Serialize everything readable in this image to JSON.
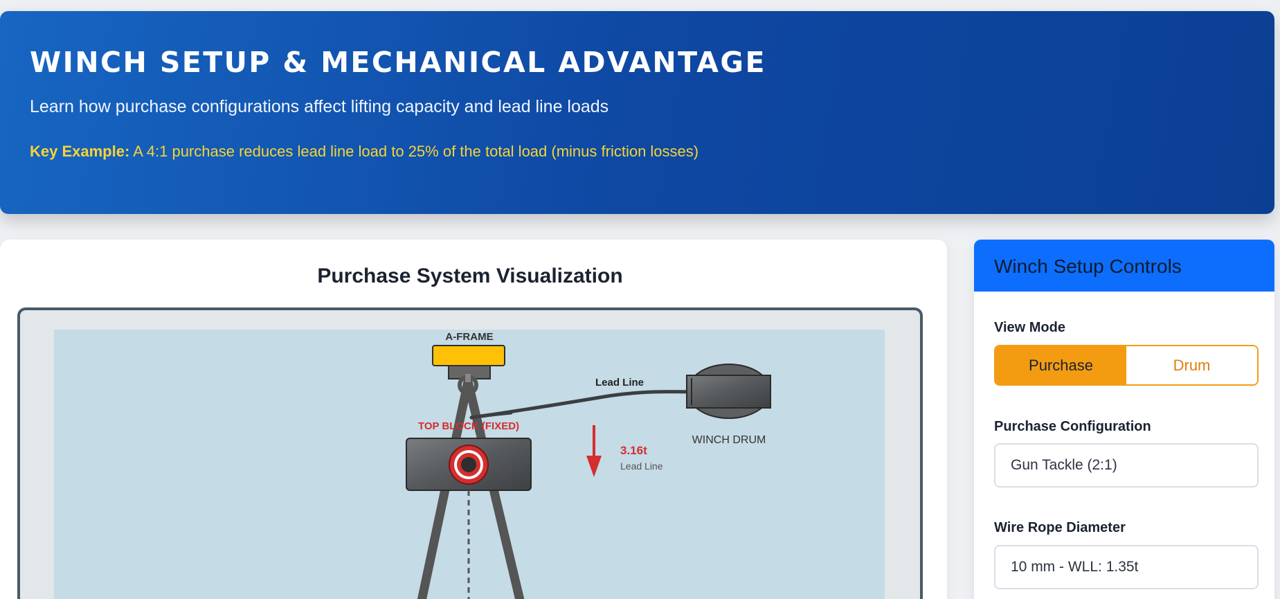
{
  "hero": {
    "title": "Winch Setup & Mechanical Advantage",
    "subtitle": "Learn how purchase configurations affect lifting capacity and lead line loads",
    "key_label": "Key Example:",
    "key_text": " A 4:1 purchase reduces lead line load to 25% of the total load (minus friction losses)"
  },
  "viz": {
    "title": "Purchase System Visualization",
    "aframe_label": "A-FRAME",
    "lead_line_label": "Lead Line",
    "top_block_label": "TOP BLOCK (FIXED)",
    "winch_drum_label": "WINCH DRUM",
    "load_value": "3.16t",
    "load_caption": "Lead Line"
  },
  "controls": {
    "title": "Winch Setup Controls",
    "view_mode_label": "View Mode",
    "view_modes": [
      "Purchase",
      "Drum"
    ],
    "active_view_mode": "Purchase",
    "purchase_config_label": "Purchase Configuration",
    "purchase_config_value": "Gun Tackle (2:1)",
    "wire_rope_label": "Wire Rope Diameter",
    "wire_rope_value": "10 mm - WLL: 1.35t"
  },
  "colors": {
    "hero_gradient_start": "#1766c2",
    "hero_gradient_end": "#0b3f94",
    "key_example": "#f7d437",
    "accent_orange": "#f39c12",
    "controls_header": "#0d6efd",
    "top_block_label": "#d32f2f",
    "load_arrow": "#d32f2f"
  }
}
